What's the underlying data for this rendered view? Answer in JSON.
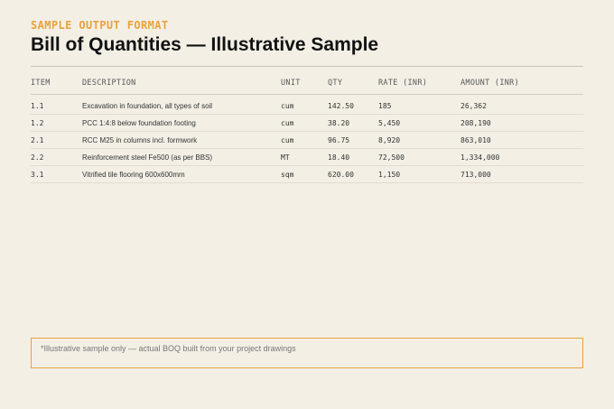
{
  "eyebrow": "SAMPLE OUTPUT FORMAT",
  "title": "Bill of Quantities — Illustrative Sample",
  "table": {
    "headers": {
      "item": "ITEM",
      "description": "DESCRIPTION",
      "unit": "UNIT",
      "qty": "QTY",
      "rate": "RATE (INR)",
      "amount": "AMOUNT (INR)"
    },
    "rows": [
      {
        "item": "1.1",
        "description": "Excavation in foundation, all types of soil",
        "unit": "cum",
        "qty": "142.50",
        "rate": "185",
        "amount": "26,362"
      },
      {
        "item": "1.2",
        "description": "PCC 1:4:8 below foundation footing",
        "unit": "cum",
        "qty": "38.20",
        "rate": "5,450",
        "amount": "208,190"
      },
      {
        "item": "2.1",
        "description": "RCC M25 in columns incl. formwork",
        "unit": "cum",
        "qty": "96.75",
        "rate": "8,920",
        "amount": "863,010"
      },
      {
        "item": "2.2",
        "description": "Reinforcement steel Fe500 (as per BBS)",
        "unit": "MT",
        "qty": "18.40",
        "rate": "72,500",
        "amount": "1,334,000"
      },
      {
        "item": "3.1",
        "description": "Vitrified tile flooring 600x600mm",
        "unit": "sqm",
        "qty": "620.00",
        "rate": "1,150",
        "amount": "713,000"
      }
    ]
  },
  "note": "*Illustrative sample only — actual BOQ built from your project drawings",
  "colors": {
    "background": "#f3efe5",
    "accent": "#e8a23c",
    "text": "#111111"
  }
}
